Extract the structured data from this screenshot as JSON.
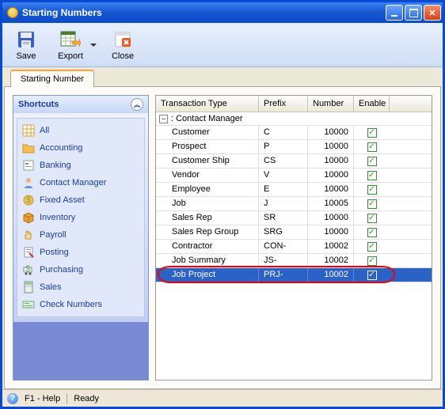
{
  "window": {
    "title": "Starting Numbers"
  },
  "toolbar": {
    "save": "Save",
    "export": "Export",
    "close": "Close"
  },
  "tabs": {
    "starting_number": "Starting Number"
  },
  "shortcuts": {
    "header": "Shortcuts",
    "items": [
      {
        "label": "All",
        "icon": "grid"
      },
      {
        "label": "Accounting",
        "icon": "folder"
      },
      {
        "label": "Banking",
        "icon": "bank"
      },
      {
        "label": "Contact Manager",
        "icon": "contact"
      },
      {
        "label": "Fixed Asset",
        "icon": "asset"
      },
      {
        "label": "Inventory",
        "icon": "box"
      },
      {
        "label": "Payroll",
        "icon": "hand"
      },
      {
        "label": "Posting",
        "icon": "post"
      },
      {
        "label": "Purchasing",
        "icon": "cart"
      },
      {
        "label": "Sales",
        "icon": "calc"
      },
      {
        "label": "Check Numbers",
        "icon": "check"
      }
    ]
  },
  "grid": {
    "columns": {
      "type": "Transaction Type",
      "prefix": "Prefix",
      "number": "Number",
      "enable": "Enable"
    },
    "group": ": Contact Manager",
    "rows": [
      {
        "type": "Customer",
        "prefix": "C",
        "number": "10000",
        "enable": true,
        "selected": false
      },
      {
        "type": "Prospect",
        "prefix": "P",
        "number": "10000",
        "enable": true,
        "selected": false
      },
      {
        "type": "Customer Ship",
        "prefix": "CS",
        "number": "10000",
        "enable": true,
        "selected": false
      },
      {
        "type": "Vendor",
        "prefix": "V",
        "number": "10000",
        "enable": true,
        "selected": false
      },
      {
        "type": "Employee",
        "prefix": "E",
        "number": "10000",
        "enable": true,
        "selected": false
      },
      {
        "type": "Job",
        "prefix": "J",
        "number": "10005",
        "enable": true,
        "selected": false
      },
      {
        "type": "Sales Rep",
        "prefix": "SR",
        "number": "10000",
        "enable": true,
        "selected": false
      },
      {
        "type": "Sales Rep Group",
        "prefix": "SRG",
        "number": "10000",
        "enable": true,
        "selected": false
      },
      {
        "type": "Contractor",
        "prefix": "CON-",
        "number": "10002",
        "enable": true,
        "selected": false
      },
      {
        "type": "Job Summary",
        "prefix": "JS-",
        "number": "10002",
        "enable": true,
        "selected": false
      },
      {
        "type": "Job Project",
        "prefix": "PRJ-",
        "number": "10002",
        "enable": true,
        "selected": true
      }
    ]
  },
  "statusbar": {
    "help": "F1 - Help",
    "state": "Ready"
  }
}
